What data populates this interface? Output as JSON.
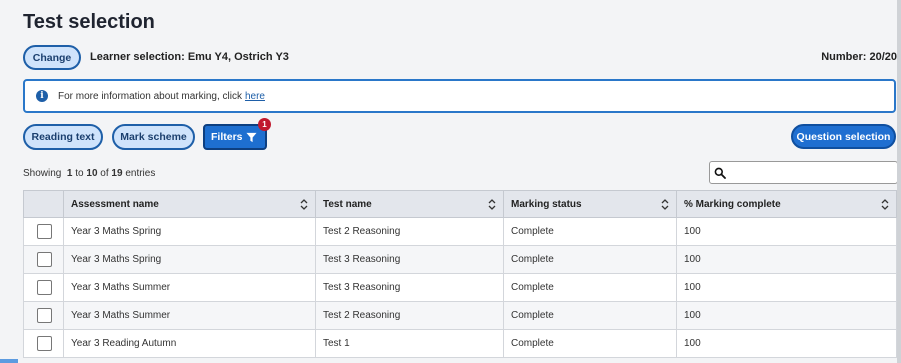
{
  "page": {
    "title": "Test selection"
  },
  "learner": {
    "change_label": "Change",
    "selection_text": "Learner selection: Emu Y4, Ostrich Y3",
    "number_text": "Number: 20/20"
  },
  "info": {
    "text": "For more information about marking, click",
    "link": "here",
    "icon": "info-icon"
  },
  "toolbar": {
    "reading_text": "Reading text",
    "mark_scheme": "Mark scheme",
    "filters": "Filters",
    "filters_badge": "1",
    "question_selection": "Question selection"
  },
  "entries": {
    "prefix": "Showing",
    "from": "1",
    "to_word": "to",
    "to": "10",
    "of_word": "of",
    "total": "19",
    "suffix": "entries"
  },
  "search": {
    "placeholder": "",
    "icon": "search-icon"
  },
  "table": {
    "headers": [
      "Assessment name",
      "Test name",
      "Marking status",
      "% Marking complete"
    ],
    "rows": [
      [
        "Year 3 Maths Spring",
        "Test 2 Reasoning",
        "Complete",
        "100"
      ],
      [
        "Year 3 Maths Spring",
        "Test 3 Reasoning",
        "Complete",
        "100"
      ],
      [
        "Year 3 Maths Summer",
        "Test 3 Reasoning",
        "Complete",
        "100"
      ],
      [
        "Year 3 Maths Summer",
        "Test 2 Reasoning",
        "Complete",
        "100"
      ],
      [
        "Year 3 Reading Autumn",
        "Test 1",
        "Complete",
        "100"
      ]
    ]
  },
  "colors": {
    "accent": "#1e6fd0",
    "pill_bg": "#cfe3fb",
    "badge": "#c0192e"
  }
}
